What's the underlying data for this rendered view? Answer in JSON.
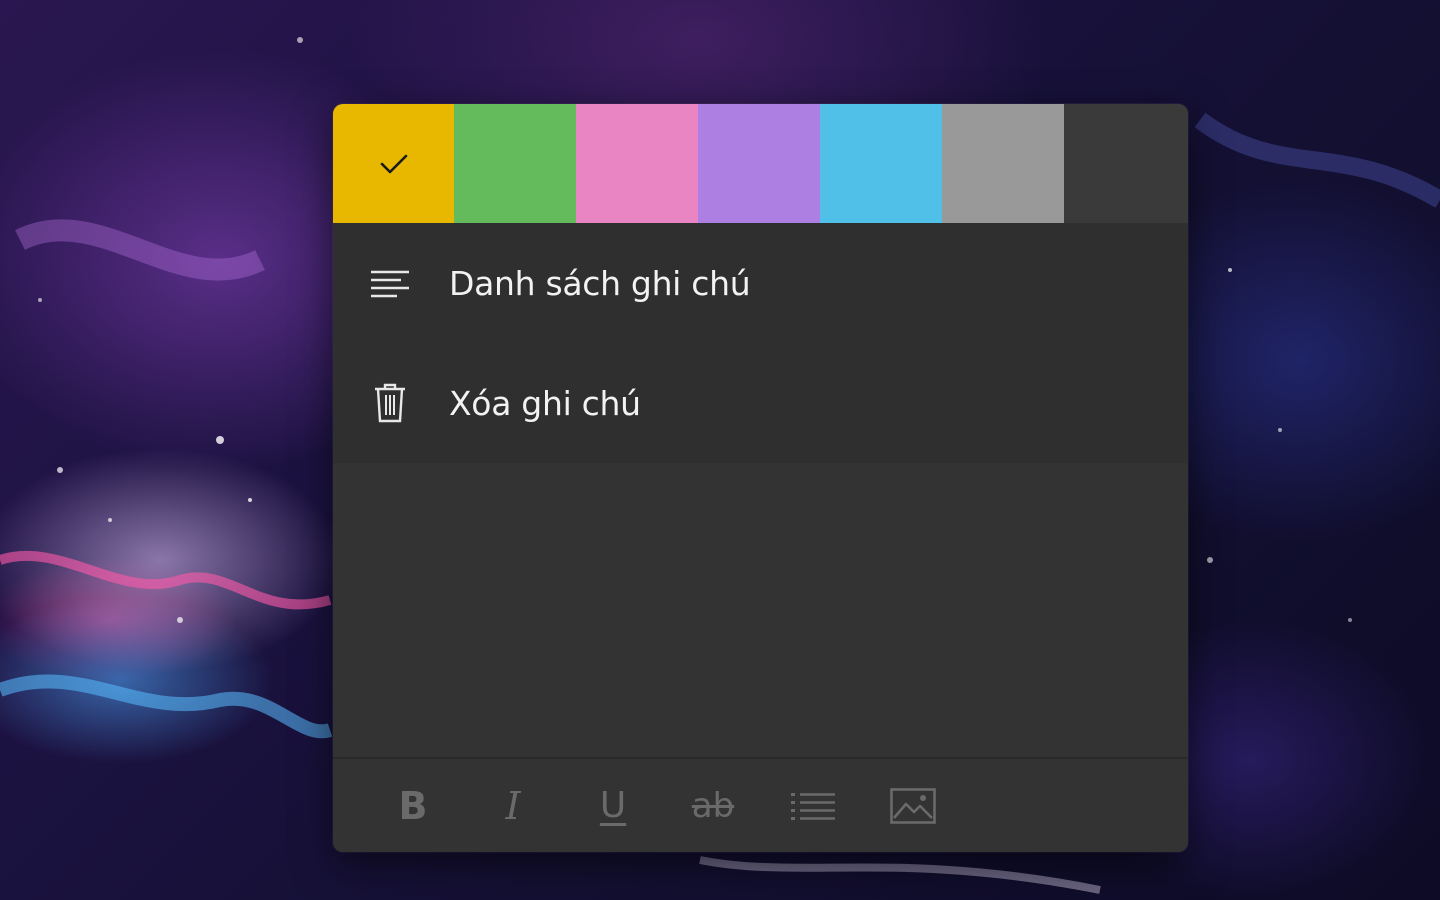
{
  "note_menu": {
    "colors": [
      {
        "name": "yellow",
        "hex": "#E8B800",
        "selected": true
      },
      {
        "name": "green",
        "hex": "#63BB5B",
        "selected": false
      },
      {
        "name": "pink",
        "hex": "#EA85C4",
        "selected": false
      },
      {
        "name": "purple",
        "hex": "#AE7FE2",
        "selected": false
      },
      {
        "name": "blue",
        "hex": "#51C0E8",
        "selected": false
      },
      {
        "name": "gray",
        "hex": "#999999",
        "selected": false
      },
      {
        "name": "charcoal",
        "hex": "#3A3A3A",
        "selected": false
      }
    ],
    "selected_icon": "checkmark-icon",
    "items": [
      {
        "icon": "notes-list-icon",
        "label": "Danh sách ghi chú"
      },
      {
        "icon": "trash-icon",
        "label": "Xóa ghi chú"
      }
    ]
  },
  "toolbar": {
    "bold": {
      "icon": "bold-icon",
      "glyph": "B"
    },
    "italic": {
      "icon": "italic-icon",
      "glyph": "I"
    },
    "underline": {
      "icon": "underline-icon",
      "glyph": "U"
    },
    "strikethrough": {
      "icon": "strikethrough-icon",
      "glyph": "ab"
    },
    "list": {
      "icon": "bulleted-list-icon"
    },
    "image": {
      "icon": "insert-image-icon"
    }
  }
}
